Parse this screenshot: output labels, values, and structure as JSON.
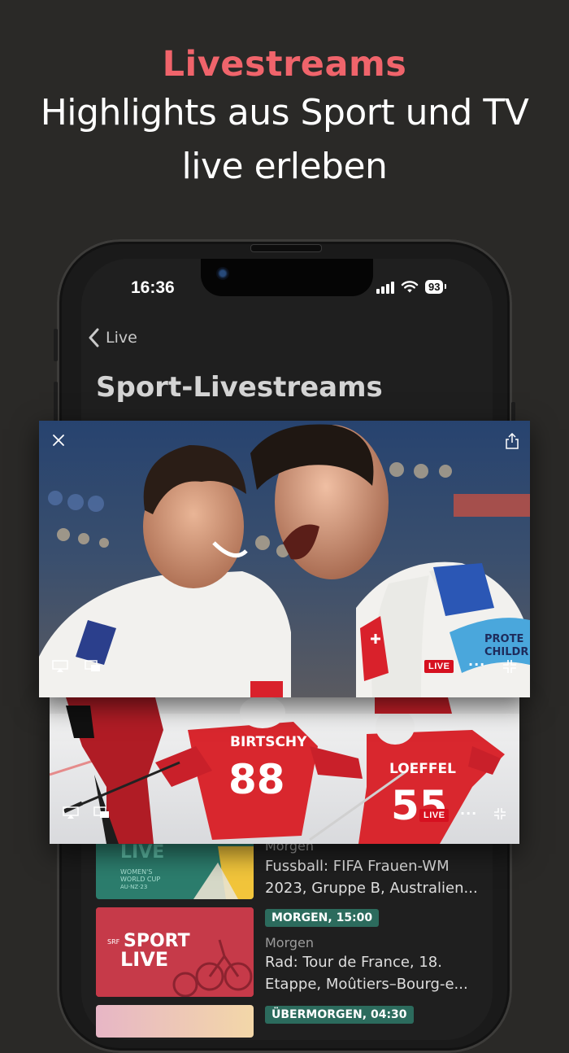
{
  "promo": {
    "kicker": "Livestreams",
    "line1": "Highlights aus Sport und TV",
    "line2": "live erleben",
    "accent_color": "#f0646b"
  },
  "status_bar": {
    "time": "16:36",
    "battery": "93"
  },
  "nav": {
    "back_label": "Live"
  },
  "page": {
    "title": "Sport-Livestreams"
  },
  "video_player_1": {
    "live_label": "LIVE",
    "more_label": "···"
  },
  "video_player_2": {
    "live_label": "LIVE",
    "more_label": "···"
  },
  "list": [
    {
      "subtitle": "Morgen",
      "title": "Fussball: FIFA Frauen-WM 2023, Gruppe B, Australien..."
    },
    {
      "badge": "MORGEN, 15:00",
      "subtitle": "Morgen",
      "title": "Rad: Tour de France, 18. Etappe, Moûtiers–Bourg-e..."
    },
    {
      "badge": "ÜBERMORGEN, 04:30"
    }
  ]
}
